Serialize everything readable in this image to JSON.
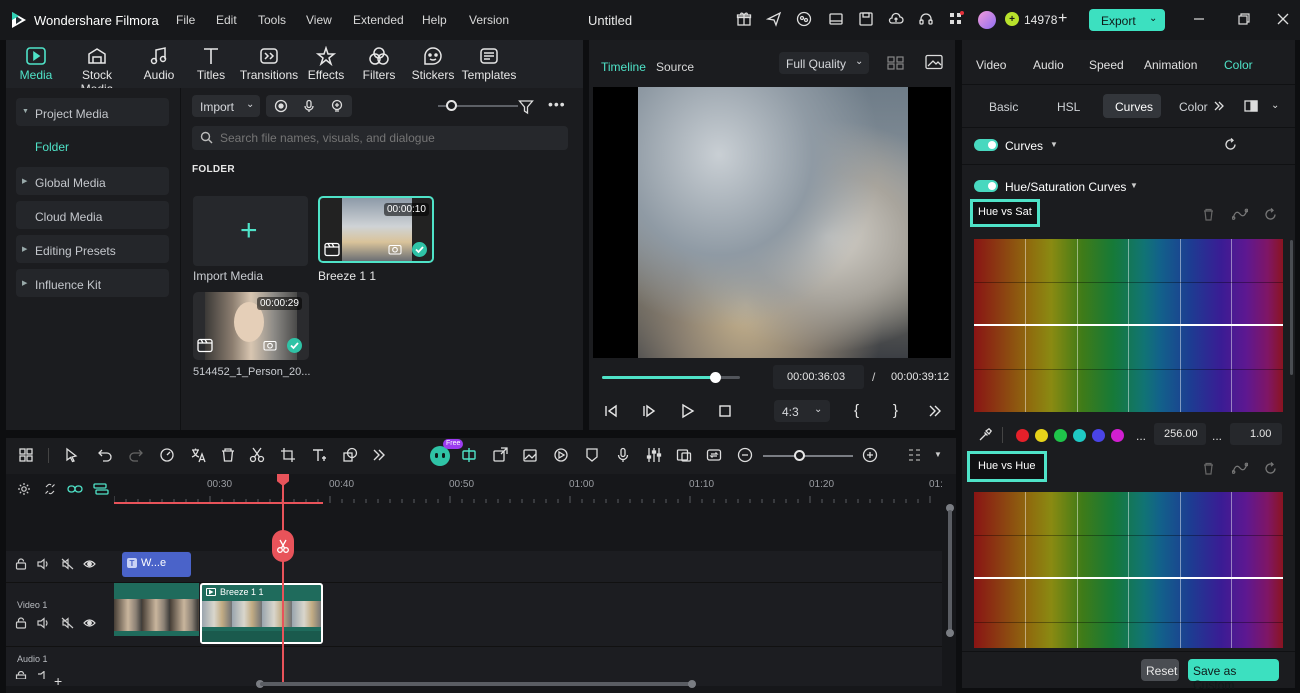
{
  "app": {
    "name": "Wondershare Filmora",
    "project": "Untitled"
  },
  "menus": [
    "File",
    "Edit",
    "Tools",
    "View",
    "Extended",
    "Help",
    "Version"
  ],
  "credits": "14978",
  "export_label": "Export",
  "tools": [
    "Media",
    "Stock Media",
    "Audio",
    "Titles",
    "Transitions",
    "Effects",
    "Filters",
    "Stickers",
    "Templates"
  ],
  "sidebar": {
    "project_media": "Project Media",
    "folder": "Folder",
    "global_media": "Global Media",
    "cloud_media": "Cloud Media",
    "editing_presets": "Editing Presets",
    "influence_kit": "Influence Kit"
  },
  "media": {
    "import_label": "Import",
    "search_placeholder": "Search file names, visuals, and dialogue",
    "folder_heading": "FOLDER",
    "import_media_label": "Import Media",
    "items": [
      {
        "name": "Breeze 1 1",
        "duration": "00:00:10"
      },
      {
        "name": "514452_1_Person_20...",
        "duration": "00:00:29"
      }
    ]
  },
  "preview": {
    "tab_timeline": "Timeline",
    "tab_source": "Source",
    "quality": "Full Quality",
    "current_time": "00:00:36:03",
    "separator": "/",
    "total_time": "00:00:39:12",
    "aspect": "4:3",
    "progress": 0.92
  },
  "color_panel": {
    "tabs": [
      "Video",
      "Audio",
      "Speed",
      "Animation",
      "Color"
    ],
    "subtabs": [
      "Basic",
      "HSL",
      "Curves",
      "Color"
    ],
    "curves_label": "Curves",
    "hs_curves_label": "Hue/Saturation Curves",
    "hue_vs_sat": "Hue vs Sat",
    "hue_vs_hue": "Hue vs Hue",
    "swatch_colors": [
      "#e5202a",
      "#e6d21a",
      "#1fc44a",
      "#1fc9c4",
      "#4a44e6",
      "#d11fd1"
    ],
    "ellipsis": "...",
    "value_a": "256.00",
    "value_b": "1.00",
    "reset": "Reset",
    "save_custom": "Save as Custom"
  },
  "timeline": {
    "ticks": [
      "00:30",
      "00:40",
      "00:50",
      "01:00",
      "01:10",
      "01:20",
      "01:"
    ],
    "free_badge": "Free",
    "tracks": {
      "video": "Video 1",
      "audio": "Audio 1"
    },
    "clips": {
      "title": "W...e",
      "video": "Breeze 1 1"
    }
  }
}
